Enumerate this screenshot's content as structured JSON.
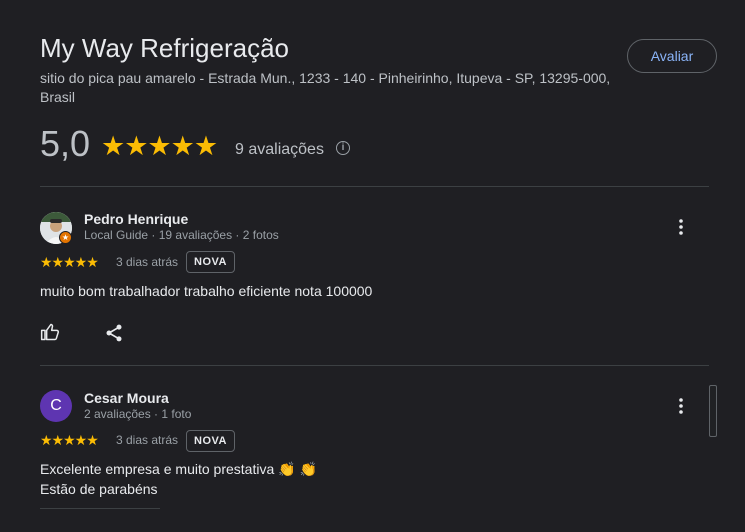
{
  "place": {
    "title": "My Way Refrigeração",
    "address": "sitio do pica pau amarelo - Estrada Mun., 1233 - 140 - Pinheirinho, Itupeva - SP, 13295-000, Brasil",
    "rate_button": "Avaliar",
    "score": "5,0",
    "stars": "★★★★★",
    "review_count": "9 avaliações",
    "info_icon": "i"
  },
  "reviews": [
    {
      "author": "Pedro Henrique",
      "meta": "Local Guide · 19 avaliações · 2 fotos",
      "stars": "★★★★★",
      "ago": "3 dias atrás",
      "badge": "NOVA",
      "text": "muito bom trabalhador trabalho eficiente nota 100000"
    },
    {
      "author": "Cesar Moura",
      "avatar_letter": "C",
      "meta": "2 avaliações · 1 foto",
      "stars": "★★★★★",
      "ago": "3 dias atrás",
      "badge": "NOVA",
      "text_line1": "Excelente empresa e muito prestativa 👏 👏",
      "text_line2": "Estão de parabéns"
    }
  ],
  "colors": {
    "background": "#1f1f23",
    "accent": "#8ab4f8",
    "star": "#fbbc04",
    "avatar_cesar": "#5e35b1"
  }
}
